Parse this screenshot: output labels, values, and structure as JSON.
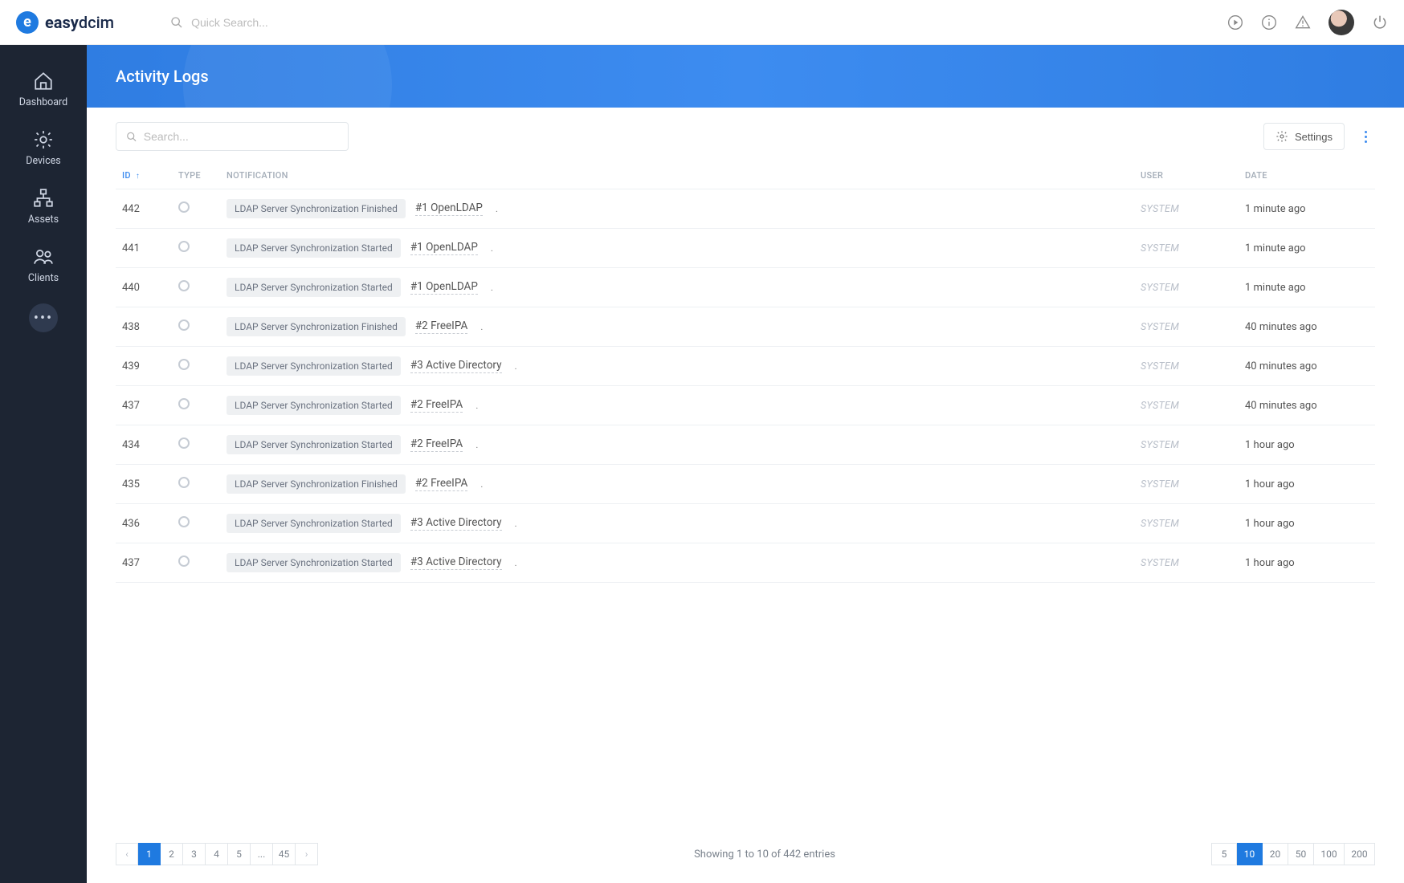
{
  "brand": {
    "name_bold": "easy",
    "name_light": "dcim"
  },
  "topbar": {
    "search_placeholder": "Quick Search..."
  },
  "sidebar": {
    "items": [
      {
        "label": "Dashboard"
      },
      {
        "label": "Devices"
      },
      {
        "label": "Assets"
      },
      {
        "label": "Clients"
      }
    ]
  },
  "page": {
    "title": "Activity Logs"
  },
  "toolbar": {
    "search_placeholder": "Search...",
    "settings_label": "Settings"
  },
  "columns": {
    "id": "ID",
    "type": "TYPE",
    "notification": "NOTIFICATION",
    "user": "USER",
    "date": "DATE"
  },
  "rows": [
    {
      "id": "442",
      "tag": "LDAP Server Synchronization Finished",
      "link": "#1 OpenLDAP",
      "user": "SYSTEM",
      "date": "1 minute ago"
    },
    {
      "id": "441",
      "tag": "LDAP Server Synchronization Started",
      "link": "#1 OpenLDAP",
      "user": "SYSTEM",
      "date": "1 minute ago"
    },
    {
      "id": "440",
      "tag": "LDAP Server Synchronization Started",
      "link": "#1 OpenLDAP",
      "user": "SYSTEM",
      "date": "1 minute ago"
    },
    {
      "id": "438",
      "tag": "LDAP Server Synchronization Finished",
      "link": "#2 FreeIPA",
      "user": "SYSTEM",
      "date": "40 minutes ago"
    },
    {
      "id": "439",
      "tag": "LDAP Server Synchronization Started",
      "link": "#3 Active Directory",
      "user": "SYSTEM",
      "date": "40 minutes ago"
    },
    {
      "id": "437",
      "tag": "LDAP Server Synchronization Started",
      "link": "#2 FreeIPA",
      "user": "SYSTEM",
      "date": "40 minutes ago"
    },
    {
      "id": "434",
      "tag": "LDAP Server Synchronization Started",
      "link": "#2 FreeIPA",
      "user": "SYSTEM",
      "date": "1 hour ago"
    },
    {
      "id": "435",
      "tag": "LDAP Server Synchronization Finished",
      "link": "#2 FreeIPA",
      "user": "SYSTEM",
      "date": "1 hour ago"
    },
    {
      "id": "436",
      "tag": "LDAP Server Synchronization Started",
      "link": "#3 Active Directory",
      "user": "SYSTEM",
      "date": "1 hour ago"
    },
    {
      "id": "437",
      "tag": "LDAP Server Synchronization Started",
      "link": "#3 Active Directory",
      "user": "SYSTEM",
      "date": "1 hour ago"
    }
  ],
  "footer": {
    "showing": "Showing 1 to 10 of 442 entries",
    "pages": [
      "1",
      "2",
      "3",
      "4",
      "5",
      "...",
      "45"
    ],
    "active_page": "1",
    "sizes": [
      "5",
      "10",
      "20",
      "50",
      "100",
      "200"
    ],
    "active_size": "10"
  }
}
